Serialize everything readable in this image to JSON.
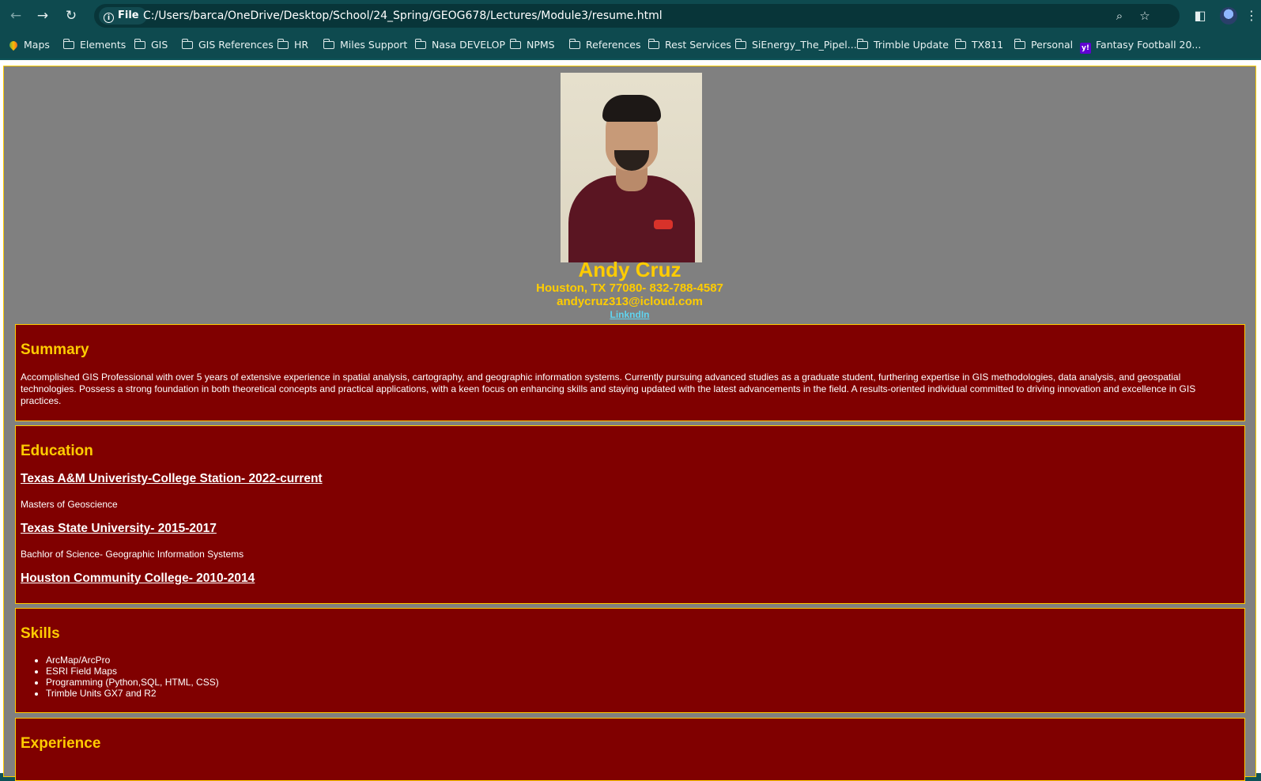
{
  "browser": {
    "site_info_label": "File",
    "url": "C:/Users/barca/OneDrive/Desktop/School/24_Spring/GEOG678/Lectures/Module3/resume.html"
  },
  "bookmarks": [
    {
      "label": "Maps",
      "icon": "maps-pin-icon"
    },
    {
      "label": "Elements",
      "icon": "folder-icon"
    },
    {
      "label": "GIS",
      "icon": "folder-icon"
    },
    {
      "label": "GIS References",
      "icon": "folder-icon"
    },
    {
      "label": "HR",
      "icon": "folder-icon"
    },
    {
      "label": "Miles Support",
      "icon": "folder-icon"
    },
    {
      "label": "Nasa DEVELOP",
      "icon": "folder-icon"
    },
    {
      "label": "NPMS",
      "icon": "folder-icon"
    },
    {
      "label": "References",
      "icon": "folder-icon"
    },
    {
      "label": "Rest Services",
      "icon": "folder-icon"
    },
    {
      "label": "SiEnergy_The_Pipel...",
      "icon": "folder-icon"
    },
    {
      "label": "Trimble Update",
      "icon": "folder-icon"
    },
    {
      "label": "TX811",
      "icon": "folder-icon"
    },
    {
      "label": "Personal",
      "icon": "folder-icon"
    },
    {
      "label": "Fantasy Football 20...",
      "icon": "yahoo-icon"
    }
  ],
  "colors": {
    "chrome": "#0e4a4f",
    "page_bg": "#808080",
    "section_bg": "#800000",
    "accent": "#ffcc00",
    "link": "#5fd4f0"
  },
  "header": {
    "name": "Andy Cruz",
    "location": "Houston, TX 77080- 832-788-4587",
    "email": "andycruz313@icloud.com",
    "linkedin": "LinkndIn"
  },
  "summary": {
    "title": "Summary",
    "text": "Accomplished GIS Professional with over 5 years of extensive experience in spatial analysis, cartography, and geographic information systems. Currently pursuing advanced studies as a graduate student, furthering expertise in GIS methodologies, data analysis, and geospatial technologies. Possess a strong foundation in both theoretical concepts and practical applications, with a keen focus on enhancing skills and staying updated with the latest advancements in the field. A results-oriented individual committed to driving innovation and excellence in GIS practices."
  },
  "education": {
    "title": "Education",
    "entries": [
      {
        "school": "Texas A&M Univeristy-College Station- 2022-current",
        "degree": "Masters of Geoscience"
      },
      {
        "school": "Texas State University- 2015-2017",
        "degree": "Bachlor of Science- Geographic Information Systems"
      },
      {
        "school": "Houston Community College- 2010-2014",
        "degree": ""
      }
    ]
  },
  "skills": {
    "title": "Skills",
    "items": [
      "ArcMap/ArcPro",
      "ESRI Field Maps",
      "Programming (Python,SQL, HTML, CSS)",
      "Trimble Units GX7 and R2"
    ]
  },
  "experience": {
    "title": "Experience"
  }
}
